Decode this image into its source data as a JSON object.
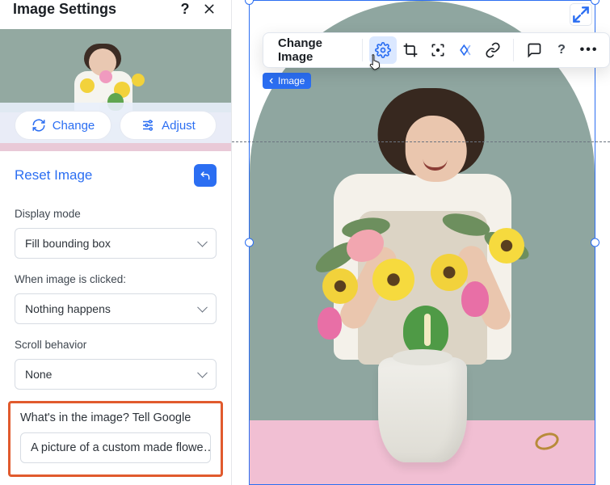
{
  "panel": {
    "title": "Image Settings",
    "change_label": "Change",
    "adjust_label": "Adjust",
    "reset_label": "Reset Image",
    "display_mode": {
      "label": "Display mode",
      "value": "Fill bounding box"
    },
    "on_click": {
      "label": "When image is clicked:",
      "value": "Nothing happens"
    },
    "scroll": {
      "label": "Scroll behavior",
      "value": "None"
    },
    "alt": {
      "label": "What's in the image? Tell Google",
      "value": "A picture of a custom made flowe…"
    }
  },
  "toolbar": {
    "change_image": "Change Image"
  },
  "breadcrumb": {
    "label": "Image"
  },
  "colors": {
    "accent": "#2b6ef2",
    "highlight_border": "#e15a2d"
  }
}
